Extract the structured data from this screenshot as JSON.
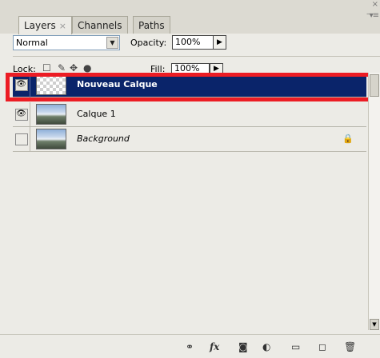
{
  "tabs": [
    {
      "label": "Layers",
      "close": "×"
    },
    {
      "label": "Channels"
    },
    {
      "label": "Paths"
    }
  ],
  "window": {
    "close_glyph": "×",
    "menu_glyph": "▾≡"
  },
  "blend": {
    "mode": "Normal",
    "dropdown_glyph": "▼"
  },
  "opacity": {
    "label": "Opacity:",
    "value": "100%",
    "arrow": "▶"
  },
  "lock": {
    "label": "Lock:"
  },
  "fill": {
    "label": "Fill:",
    "value": "100%",
    "arrow": "▶"
  },
  "layers": [
    {
      "name": "Nouveau Calque",
      "visible": true,
      "selected": true,
      "thumb": "transparent"
    },
    {
      "name": "Calque 1",
      "visible": true,
      "selected": false,
      "thumb": "sky"
    },
    {
      "name": "Background",
      "visible": false,
      "selected": false,
      "thumb": "sky",
      "locked": true
    }
  ],
  "toolbar_icons": [
    "link-icon",
    "fx-icon",
    "mask-icon",
    "adjustment-icon",
    "group-folder-icon",
    "new-layer-icon",
    "trash-icon"
  ],
  "fx_label": "fx",
  "colors": {
    "selection": "#0a246a",
    "highlight_border": "#ec1c24",
    "panel_bg": "#ecebe6"
  }
}
